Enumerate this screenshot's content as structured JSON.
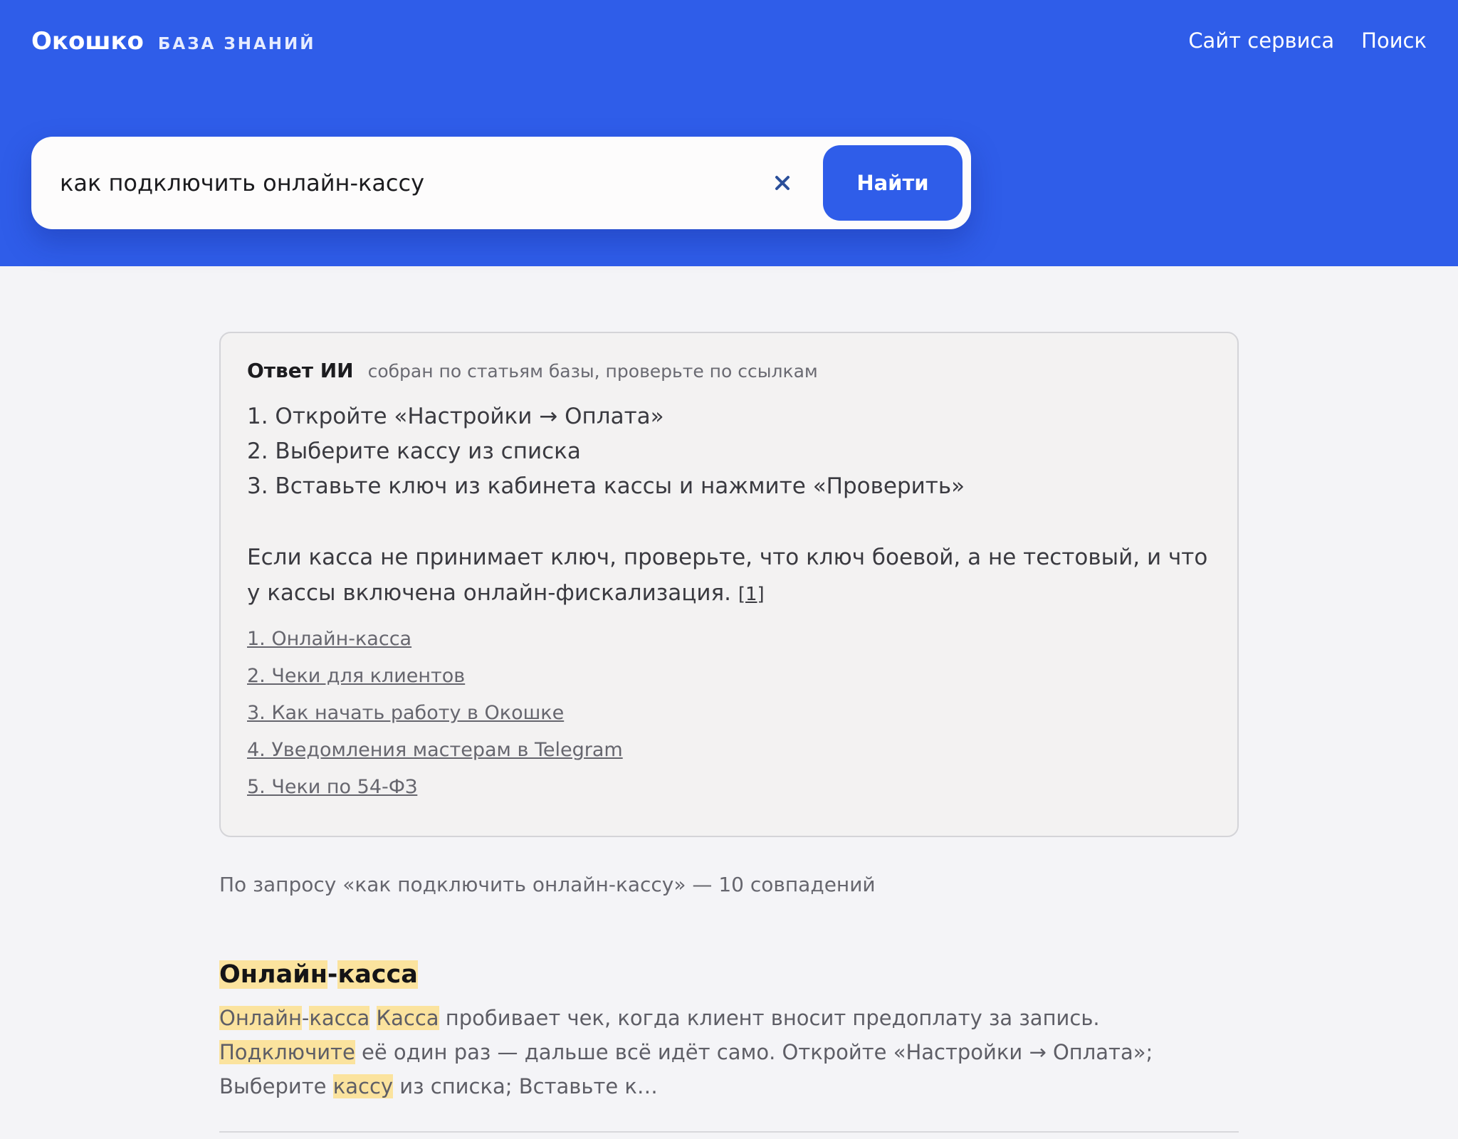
{
  "header": {
    "brand": "Окошко",
    "section": "БАЗА ЗНАНИЙ",
    "nav": [
      {
        "label": "Сайт сервиса"
      },
      {
        "label": "Поиск"
      }
    ]
  },
  "search": {
    "value": "как подключить онлайн-кассу",
    "button_label": "Найти",
    "clear_icon": "close-icon"
  },
  "ai_answer": {
    "title": "Ответ ИИ",
    "note": "собран по статьям базы, проверьте по ссылкам",
    "steps": [
      "1. Откройте «Настройки → Оплата»",
      "2. Выберите кассу из списка",
      "3. Вставьте ключ из кабинета кассы и нажмите «Проверить»"
    ],
    "paragraph": "Если касса не принимает ключ, проверьте, что ключ боевой, а не тестовый, и что у кассы включена онлайн-фискализация.",
    "citation": "[1]",
    "sources": [
      "1. Онлайн-касса",
      "2. Чеки для клиентов",
      "3. Как начать работу в Окошке",
      "4. Уведомления мастерам в Telegram",
      "5. Чеки по 54-ФЗ"
    ]
  },
  "results": {
    "summary": "По запросу «как подключить онлайн-кассу» — 10 совпадений",
    "items": [
      {
        "title": [
          {
            "text": "Онлайн",
            "hl": true
          },
          {
            "text": "-",
            "hl": false
          },
          {
            "text": "касса",
            "hl": true
          }
        ],
        "snippet": [
          {
            "text": "Онлайн",
            "hl": true
          },
          {
            "text": "-",
            "hl": false
          },
          {
            "text": "касса",
            "hl": true
          },
          {
            "text": " ",
            "hl": false
          },
          {
            "text": "Касса",
            "hl": true
          },
          {
            "text": " пробивает чек, когда клиент вносит предоплату за запись. ",
            "hl": false
          },
          {
            "text": "Подключите",
            "hl": true
          },
          {
            "text": " её один раз — дальше всё идёт само. Откройте «Настройки → Оплата»; Выберите ",
            "hl": false
          },
          {
            "text": "кассу",
            "hl": true
          },
          {
            "text": " из списка; Вставьте к…",
            "hl": false
          }
        ]
      }
    ]
  },
  "colors": {
    "brand_blue": "#2f5de9",
    "highlight": "#fbe39e",
    "page_bg": "#f4f4f7"
  }
}
